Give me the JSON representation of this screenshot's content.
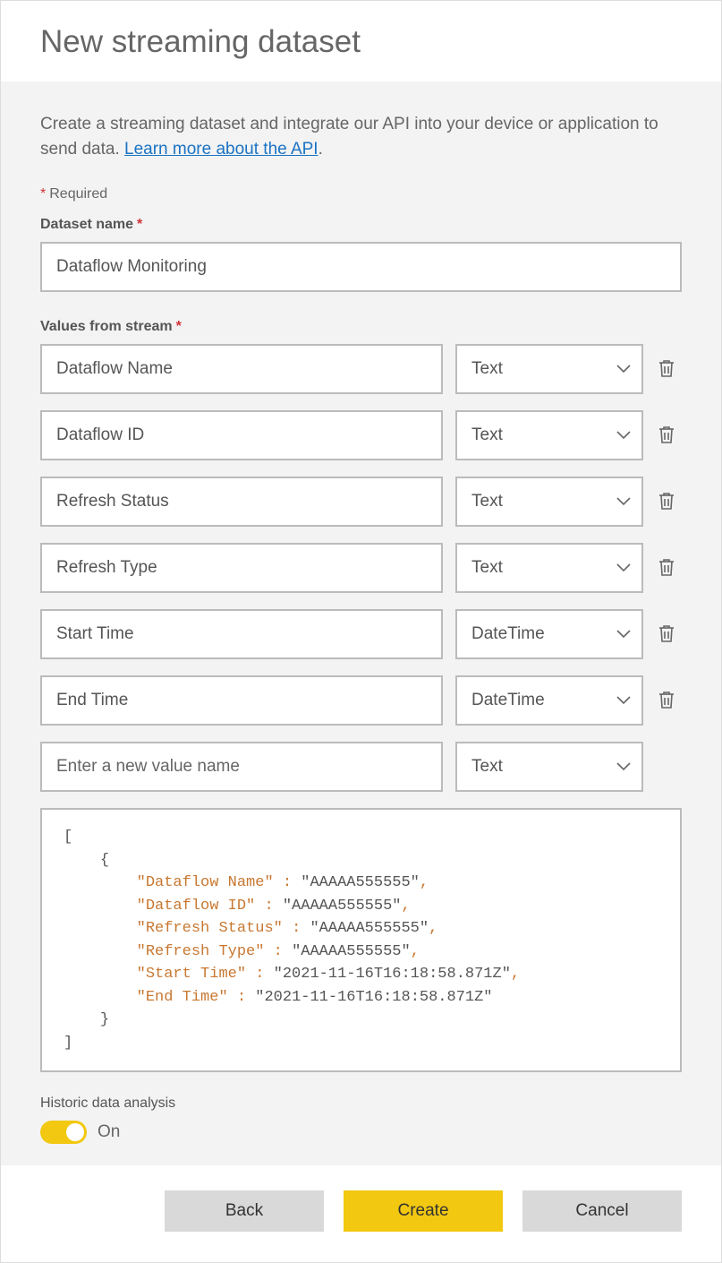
{
  "header": {
    "title": "New streaming dataset"
  },
  "intro": {
    "text_before": "Create a streaming dataset and integrate our API into your device or application to send data. ",
    "link": "Learn more about the API",
    "text_after": "."
  },
  "required_label": "Required",
  "dataset_name": {
    "label": "Dataset name",
    "value": "Dataflow Monitoring"
  },
  "values_from_stream": {
    "label": "Values from stream",
    "rows": [
      {
        "name": "Dataflow Name",
        "type": "Text"
      },
      {
        "name": "Dataflow ID",
        "type": "Text"
      },
      {
        "name": "Refresh Status",
        "type": "Text"
      },
      {
        "name": "Refresh Type",
        "type": "Text"
      },
      {
        "name": "Start Time",
        "type": "DateTime"
      },
      {
        "name": "End Time",
        "type": "DateTime"
      }
    ],
    "new_row": {
      "placeholder": "Enter a new value name",
      "type": "Text"
    }
  },
  "json_preview": {
    "lines": [
      {
        "indent": 0,
        "text": "["
      },
      {
        "indent": 1,
        "text": "{"
      },
      {
        "indent": 2,
        "key": "Dataflow Name",
        "value": "\"AAAAA555555\"",
        "comma": true
      },
      {
        "indent": 2,
        "key": "Dataflow ID",
        "value": "\"AAAAA555555\"",
        "comma": true
      },
      {
        "indent": 2,
        "key": "Refresh Status",
        "value": "\"AAAAA555555\"",
        "comma": true
      },
      {
        "indent": 2,
        "key": "Refresh Type",
        "value": "\"AAAAA555555\"",
        "comma": true
      },
      {
        "indent": 2,
        "key": "Start Time",
        "value": "\"2021-11-16T16:18:58.871Z\"",
        "comma": true
      },
      {
        "indent": 2,
        "key": "End Time",
        "value": "\"2021-11-16T16:18:58.871Z\"",
        "comma": false
      },
      {
        "indent": 1,
        "text": "}"
      },
      {
        "indent": 0,
        "text": "]"
      }
    ]
  },
  "historic": {
    "label": "Historic data analysis",
    "state_text": "On"
  },
  "footer": {
    "back": "Back",
    "create": "Create",
    "cancel": "Cancel"
  }
}
